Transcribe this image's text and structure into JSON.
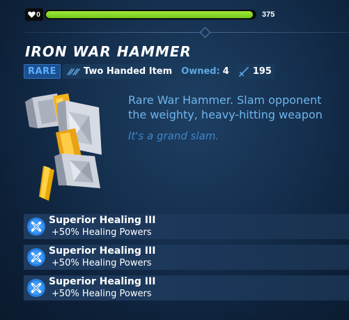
{
  "status": {
    "hearts": "0",
    "health_fraction": 0.99,
    "health_value": "375"
  },
  "item": {
    "name": "IRON WAR HAMMER",
    "rarity": "RARE",
    "type": "Two Handed Item",
    "owned_label": "Owned:",
    "owned_count": "4",
    "damage": "195",
    "description_line1": "Rare War Hammer. Slam opponent",
    "description_line2": "the weighty, heavy-hitting weapon",
    "flavor": "It's a grand slam."
  },
  "perks": [
    {
      "name": "Superior Healing III",
      "desc": "+50% Healing Powers"
    },
    {
      "name": "Superior Healing III",
      "desc": "+50% Healing Powers"
    },
    {
      "name": "Superior Healing III",
      "desc": "+50% Healing Powers"
    }
  ],
  "colors": {
    "rarity": "#5ab0ff",
    "health": "#8fd92e",
    "description": "#6fb6ec",
    "flavor": "#3e86c9"
  },
  "icons": {
    "heart": "heart-icon",
    "type": "two-handed-icon",
    "damage": "sword-icon",
    "perk": "healing-perk-icon"
  }
}
